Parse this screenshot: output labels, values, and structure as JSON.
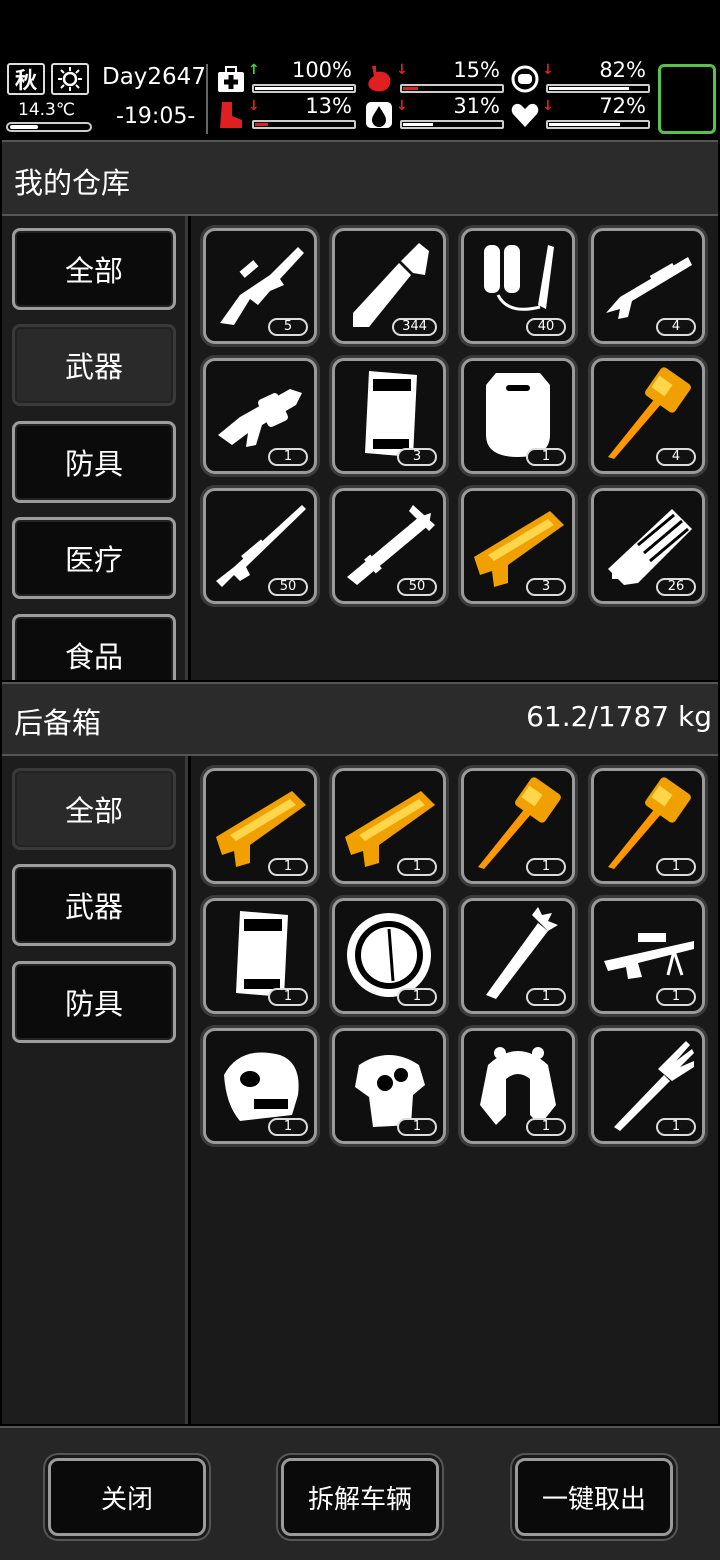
{
  "status": {
    "season": "秋",
    "temperature": "14.3℃",
    "day": "Day2647",
    "time": "-19:05-",
    "stats": [
      {
        "name": "health",
        "value": "100%",
        "level": 1.0,
        "trend": "up"
      },
      {
        "name": "hunger",
        "value": "15%",
        "level": 0.15,
        "trend": "down"
      },
      {
        "name": "mood",
        "value": "82%",
        "level": 0.82,
        "trend": "down"
      },
      {
        "name": "stamina",
        "value": "13%",
        "level": 0.13,
        "trend": "down"
      },
      {
        "name": "thirst",
        "value": "31%",
        "level": 0.31,
        "trend": "down"
      },
      {
        "name": "spirit",
        "value": "72%",
        "level": 0.72,
        "trend": "down"
      }
    ]
  },
  "warehouse": {
    "title": "我的仓库",
    "categories": [
      "全部",
      "武器",
      "防具",
      "医疗",
      "食品"
    ],
    "active_category": "武器",
    "items": [
      {
        "icon": "assault-rifle-icon",
        "count": "5"
      },
      {
        "icon": "cleaver-icon",
        "count": "344"
      },
      {
        "icon": "flamethrower-icon",
        "count": "40"
      },
      {
        "icon": "shotgun-icon",
        "count": "4"
      },
      {
        "icon": "grenade-launcher-icon",
        "count": "1"
      },
      {
        "icon": "shield-crate-icon",
        "count": "3"
      },
      {
        "icon": "riot-shield-icon",
        "count": "1"
      },
      {
        "icon": "golden-hammer-icon",
        "count": "4"
      },
      {
        "icon": "sniper-rifle-icon",
        "count": "50"
      },
      {
        "icon": "rocket-launcher-icon",
        "count": "50"
      },
      {
        "icon": "golden-blaster-icon",
        "count": "3"
      },
      {
        "icon": "minigun-icon",
        "count": "26"
      }
    ]
  },
  "trunk": {
    "title": "后备箱",
    "weight": "61.2/1787 kg",
    "categories": [
      "全部",
      "武器",
      "防具"
    ],
    "active_category": "全部",
    "items": [
      {
        "icon": "golden-blaster-icon",
        "count": "1"
      },
      {
        "icon": "golden-blaster-icon",
        "count": "1"
      },
      {
        "icon": "golden-hammer-icon",
        "count": "1"
      },
      {
        "icon": "golden-hammer-icon",
        "count": "1"
      },
      {
        "icon": "shield-crate-icon",
        "count": "1"
      },
      {
        "icon": "round-shield-icon",
        "count": "1"
      },
      {
        "icon": "spiked-club-icon",
        "count": "1"
      },
      {
        "icon": "heavy-sniper-icon",
        "count": "1"
      },
      {
        "icon": "skull-mask-icon",
        "count": "1"
      },
      {
        "icon": "armor-vest-icon",
        "count": "1"
      },
      {
        "icon": "horned-helmet-icon",
        "count": "1"
      },
      {
        "icon": "pitchfork-icon",
        "count": "1"
      }
    ]
  },
  "footer": {
    "close": "关闭",
    "dismantle": "拆解车辆",
    "take_all": "一键取出"
  },
  "colors": {
    "gold": "#f0a000",
    "green": "#56c24a",
    "red": "#e02020"
  }
}
